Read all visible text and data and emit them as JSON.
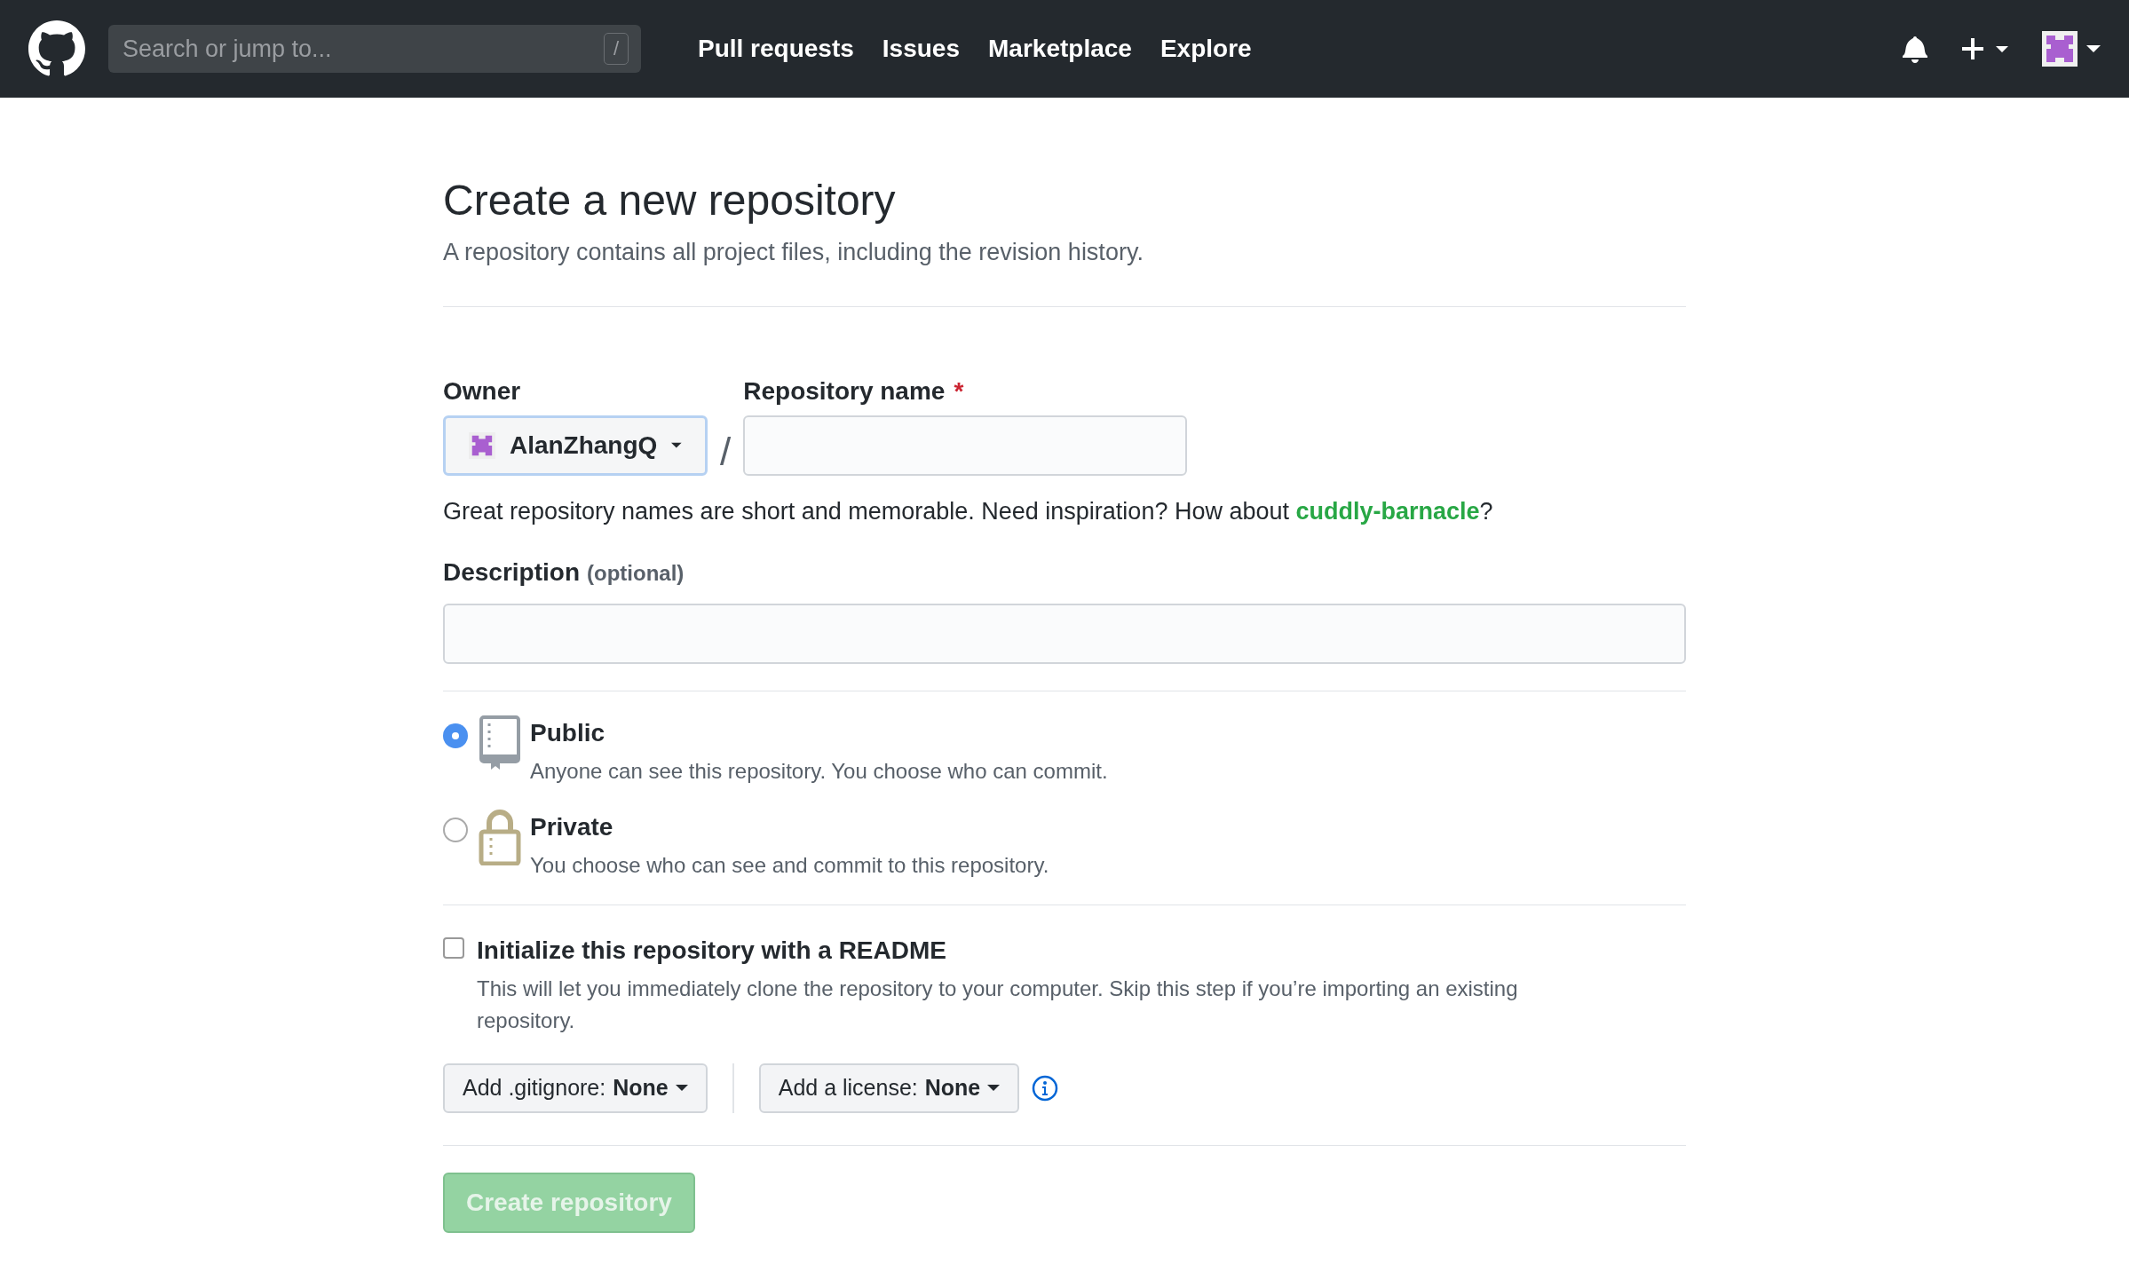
{
  "header": {
    "search": {
      "placeholder": "Search or jump to...",
      "shortcut": "/"
    },
    "nav": [
      "Pull requests",
      "Issues",
      "Marketplace",
      "Explore"
    ]
  },
  "page": {
    "title": "Create a new repository",
    "subtitle": "A repository contains all project files, including the revision history."
  },
  "owner": {
    "label": "Owner",
    "value": "AlanZhangQ"
  },
  "separator": "/",
  "repo_name": {
    "label": "Repository name",
    "required_mark": "*"
  },
  "hint": {
    "before": "Great repository names are short and memorable. Need inspiration? How about ",
    "suggestion": "cuddly-barnacle",
    "after": "?"
  },
  "description": {
    "label": "Description",
    "optional": "(optional)"
  },
  "visibility": [
    {
      "kind": "public",
      "title": "Public",
      "text": "Anyone can see this repository. You choose who can commit.",
      "selected": true
    },
    {
      "kind": "private",
      "title": "Private",
      "text": "You choose who can see and commit to this repository.",
      "selected": false
    }
  ],
  "readme": {
    "label": "Initialize this repository with a README",
    "text": "This will let you immediately clone the repository to your computer. Skip this step if you’re importing an existing repository.",
    "checked": false
  },
  "gitignore": {
    "label": "Add .gitignore:",
    "value": "None"
  },
  "license": {
    "label": "Add a license:",
    "value": "None"
  },
  "create_button": {
    "label": "Create repository",
    "disabled": true
  }
}
